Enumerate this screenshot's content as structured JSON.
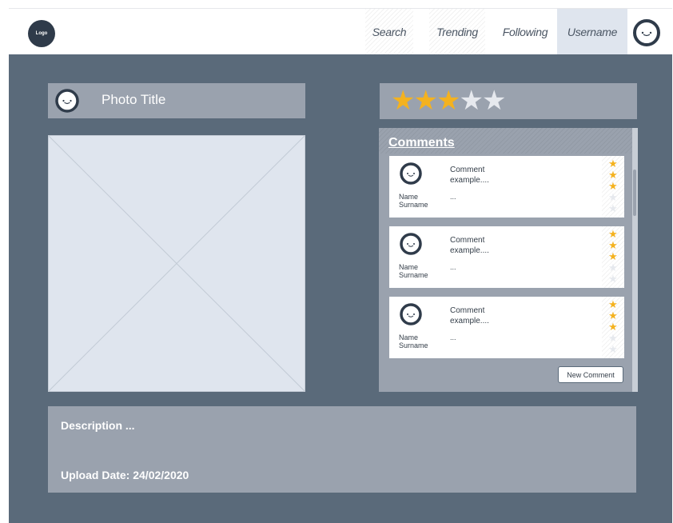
{
  "header": {
    "logo_label": "Logo",
    "nav": [
      "Search",
      "Trending",
      "Following",
      "Username"
    ]
  },
  "photo": {
    "title": "Photo Title"
  },
  "rating": {
    "value": 3,
    "max": 5
  },
  "comments": {
    "title": "Comments",
    "items": [
      {
        "name": "Name",
        "surname": "Surname",
        "text_line1": "Comment",
        "text_line2": "example....",
        "extra": "...",
        "rating": 3,
        "max": 5
      },
      {
        "name": "Name",
        "surname": "Surname",
        "text_line1": "Comment",
        "text_line2": "example....",
        "extra": "...",
        "rating": 3,
        "max": 5
      },
      {
        "name": "Name",
        "surname": "Surname",
        "text_line1": "Comment",
        "text_line2": "example....",
        "extra": "...",
        "rating": 3,
        "max": 5
      }
    ],
    "new_button": "New Comment"
  },
  "details": {
    "description": "Description ...",
    "upload_date": "Upload Date: 24/02/2020"
  },
  "colors": {
    "star_filled": "#f4b21f",
    "star_empty": "#e6e9ee",
    "panel": "#9aa2ae",
    "background": "#5a6a7a"
  },
  "icons": {
    "avatar": "smiley-avatar-icon",
    "star": "star-icon"
  }
}
